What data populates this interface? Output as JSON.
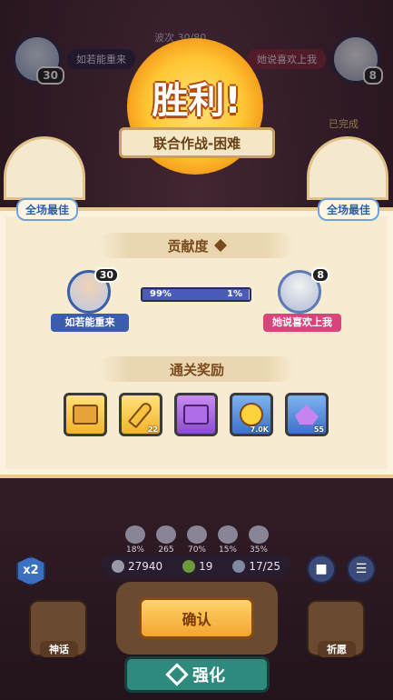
{
  "hud": {
    "wave_text": "波次 30/80",
    "left_player": {
      "name": "如若能重来",
      "level": "30"
    },
    "right_player": {
      "name": "她说喜欢上我",
      "level": "8"
    },
    "completed_tag": "已完成"
  },
  "banner": {
    "title": "胜利!",
    "subtitle": "联合作战-困难"
  },
  "best": {
    "left_label": "全场最佳",
    "right_label": "全场最佳"
  },
  "contribution": {
    "title": "贡献度",
    "left_player": {
      "name": "如若能重来",
      "level": "30",
      "percent_label": "99%"
    },
    "right_player": {
      "name": "她说喜欢上我",
      "level": "8",
      "percent_label": "1%"
    },
    "left_share": 0.99
  },
  "rewards": {
    "title": "通关奖励",
    "items": [
      {
        "icon": "gold-chest-icon",
        "qty": ""
      },
      {
        "icon": "gold-key-icon",
        "qty": "22"
      },
      {
        "icon": "purple-chest-icon",
        "qty": ""
      },
      {
        "icon": "gold-coin-icon",
        "qty": "7.0K"
      },
      {
        "icon": "purple-crystal-icon",
        "qty": "55"
      }
    ]
  },
  "stats": [
    "18%",
    "265",
    "70%",
    "15%",
    "35%"
  ],
  "resources": {
    "coins": "27940",
    "energy": "19",
    "units": "17/25"
  },
  "speed": "x2",
  "buttons": {
    "confirm": "确认",
    "upgrade": "强化",
    "myth": "神话",
    "wish": "祈愿"
  }
}
